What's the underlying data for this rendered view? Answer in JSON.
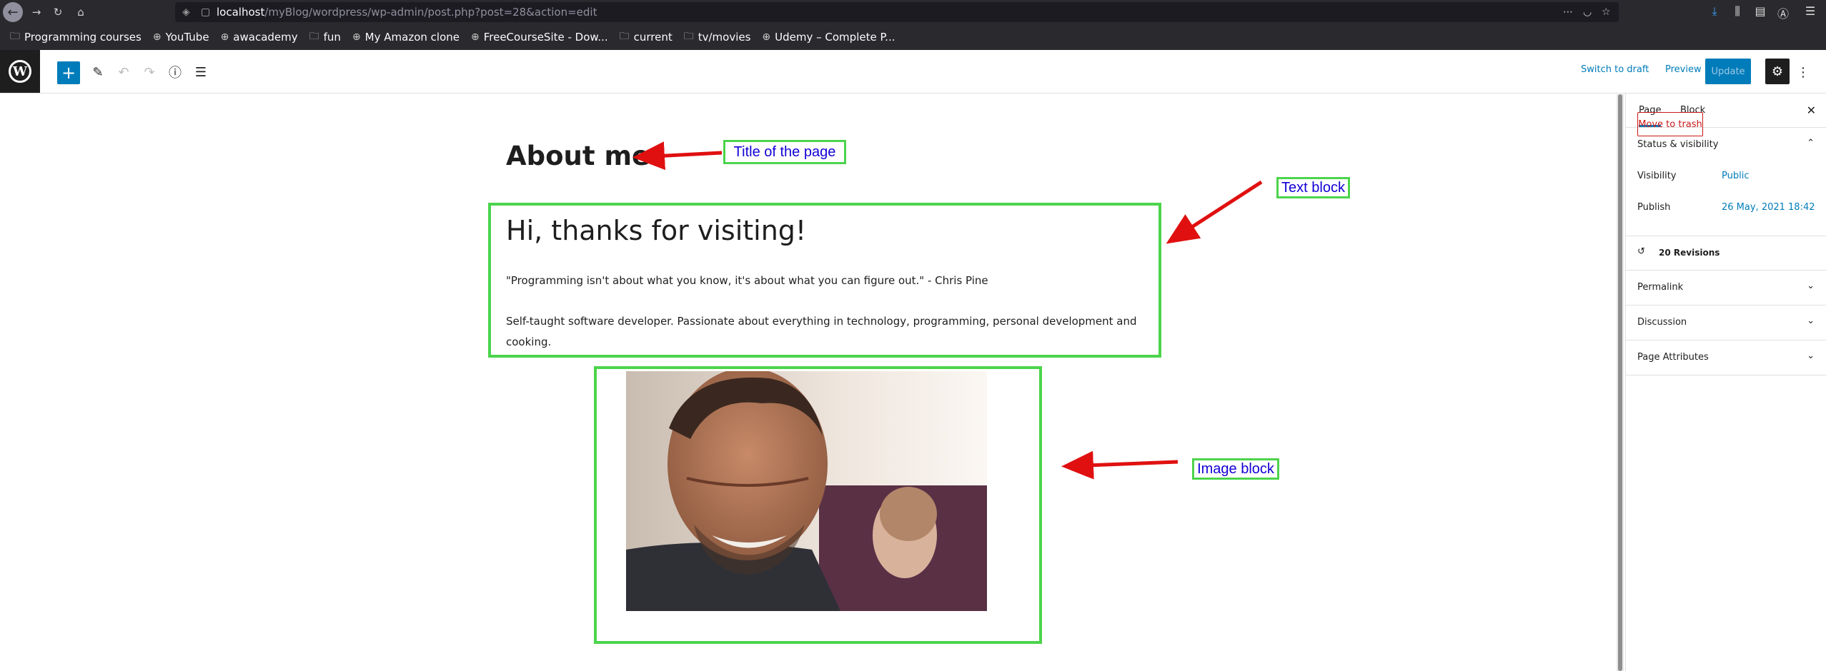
{
  "browser": {
    "url_host": "localhost",
    "url_path": "/myBlog/wordpress/wp-admin/post.php?post=28&action=edit",
    "bookmarks": [
      {
        "label": "Programming courses",
        "icon": "folder-icon"
      },
      {
        "label": "YouTube",
        "icon": "globe-icon"
      },
      {
        "label": "awacademy",
        "icon": "globe-icon"
      },
      {
        "label": "fun",
        "icon": "folder-icon"
      },
      {
        "label": "My Amazon clone",
        "icon": "globe-icon"
      },
      {
        "label": "FreeCourseSite - Dow...",
        "icon": "globe-icon"
      },
      {
        "label": "current",
        "icon": "folder-icon"
      },
      {
        "label": "tv/movies",
        "icon": "folder-icon"
      },
      {
        "label": "Udemy – Complete P...",
        "icon": "globe-icon"
      }
    ]
  },
  "toolbar": {
    "switch_to_draft": "Switch to draft",
    "preview": "Preview",
    "update": "Update"
  },
  "editor": {
    "title": "About me",
    "heading": "Hi, thanks for visiting!",
    "quote": "\"Programming isn't about what you know, it's about what you can figure out.\" - Chris Pine",
    "bio_line1": "Self-taught software developer. Passionate about everything in technology, programming, personal development and",
    "bio_line2": "cooking."
  },
  "sidebar": {
    "tab_page": "Page",
    "tab_block": "Block",
    "status_title": "Status & visibility",
    "visibility_label": "Visibility",
    "visibility_value": "Public",
    "publish_label": "Publish",
    "publish_value": "26 May, 2021 18:42",
    "move_to_trash": "Move to trash",
    "revisions": "20 Revisions",
    "permalink": "Permalink",
    "discussion": "Discussion",
    "page_attributes": "Page Attributes"
  },
  "annotations": {
    "title_label": "Title of the page",
    "text_label": "Text block",
    "image_label": "Image block"
  },
  "colors": {
    "accent": "#007cba",
    "outline": "#4cd44c",
    "arrow": "#e01010",
    "annotation_text": "#1200d6",
    "danger": "#cc1818"
  }
}
